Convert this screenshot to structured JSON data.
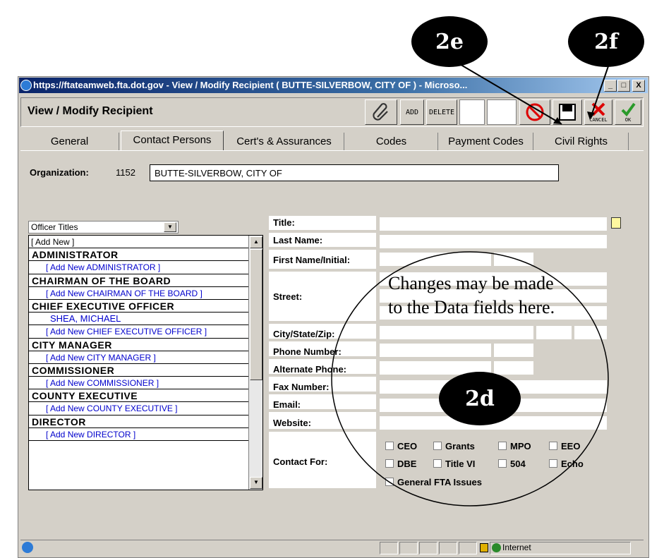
{
  "window": {
    "title": "https://ftateamweb.fta.dot.gov - View / Modify Recipient ( BUTTE-SILVERBOW, CITY OF ) - Microso...",
    "controls": [
      "_",
      "□",
      "X"
    ]
  },
  "toolbar": {
    "title": "View / Modify Recipient",
    "add_label": "ADD",
    "delete_label": "DELETE",
    "cancel_label": "CANCEL",
    "ok_label": "OK",
    "icons": [
      "paperclip-icon",
      "no-entry-icon",
      "save-icon",
      "cancel-x-icon",
      "checkmark-icon"
    ]
  },
  "tabs": [
    {
      "label": "General"
    },
    {
      "label": "Contact Persons",
      "active": true
    },
    {
      "label": "Cert's & Assurances"
    },
    {
      "label": "Codes"
    },
    {
      "label": "Payment Codes"
    },
    {
      "label": "Civil Rights"
    }
  ],
  "organization": {
    "label": "Organization:",
    "id": "1152",
    "name": "BUTTE-SILVERBOW, CITY OF"
  },
  "officer_select": {
    "selected": "Officer Titles"
  },
  "officer_list": [
    {
      "type": "first",
      "text": "[ Add New ]"
    },
    {
      "type": "head",
      "text": "ADMINISTRATOR"
    },
    {
      "type": "add",
      "text": "[ Add New ADMINISTRATOR ]"
    },
    {
      "type": "head",
      "text": "CHAIRMAN OF THE BOARD"
    },
    {
      "type": "add",
      "text": "[ Add New CHAIRMAN OF THE BOARD ]"
    },
    {
      "type": "head",
      "text": "CHIEF EXECUTIVE OFFICER"
    },
    {
      "type": "person",
      "text": "SHEA, MICHAEL"
    },
    {
      "type": "add",
      "text": "[ Add New CHIEF EXECUTIVE OFFICER ]"
    },
    {
      "type": "head",
      "text": "CITY MANAGER"
    },
    {
      "type": "add",
      "text": "[ Add New CITY MANAGER ]"
    },
    {
      "type": "head",
      "text": "COMMISSIONER"
    },
    {
      "type": "add",
      "text": "[ Add New COMMISSIONER ]"
    },
    {
      "type": "head",
      "text": "COUNTY EXECUTIVE"
    },
    {
      "type": "add",
      "text": "[ Add New COUNTY EXECUTIVE ]"
    },
    {
      "type": "head",
      "text": "DIRECTOR"
    },
    {
      "type": "add",
      "text": "[ Add New DIRECTOR ]"
    }
  ],
  "form": {
    "title": "Title:",
    "last_name": "Last Name:",
    "first_name": "First Name/Initial:",
    "street": "Street:",
    "city_state_zip": "City/State/Zip:",
    "phone": "Phone Number:",
    "alt_phone": "Alternate Phone:",
    "fax": "Fax Number:",
    "email": "Email:",
    "website": "Website:",
    "contact_for": "Contact For:"
  },
  "contact_for_options": {
    "ceo": "CEO",
    "grants": "Grants",
    "mpo": "MPO",
    "eeo": "EEO",
    "dbe": "DBE",
    "title_vi": "Title VI",
    "s504": "504",
    "echo": "Echo",
    "general": "General FTA Issues"
  },
  "annotations": {
    "bubble_2e": "2e",
    "bubble_2f": "2f",
    "bubble_2d": "2d",
    "note": "Changes may be made to the Data fields here."
  },
  "statusbar": {
    "zone": "Internet"
  }
}
